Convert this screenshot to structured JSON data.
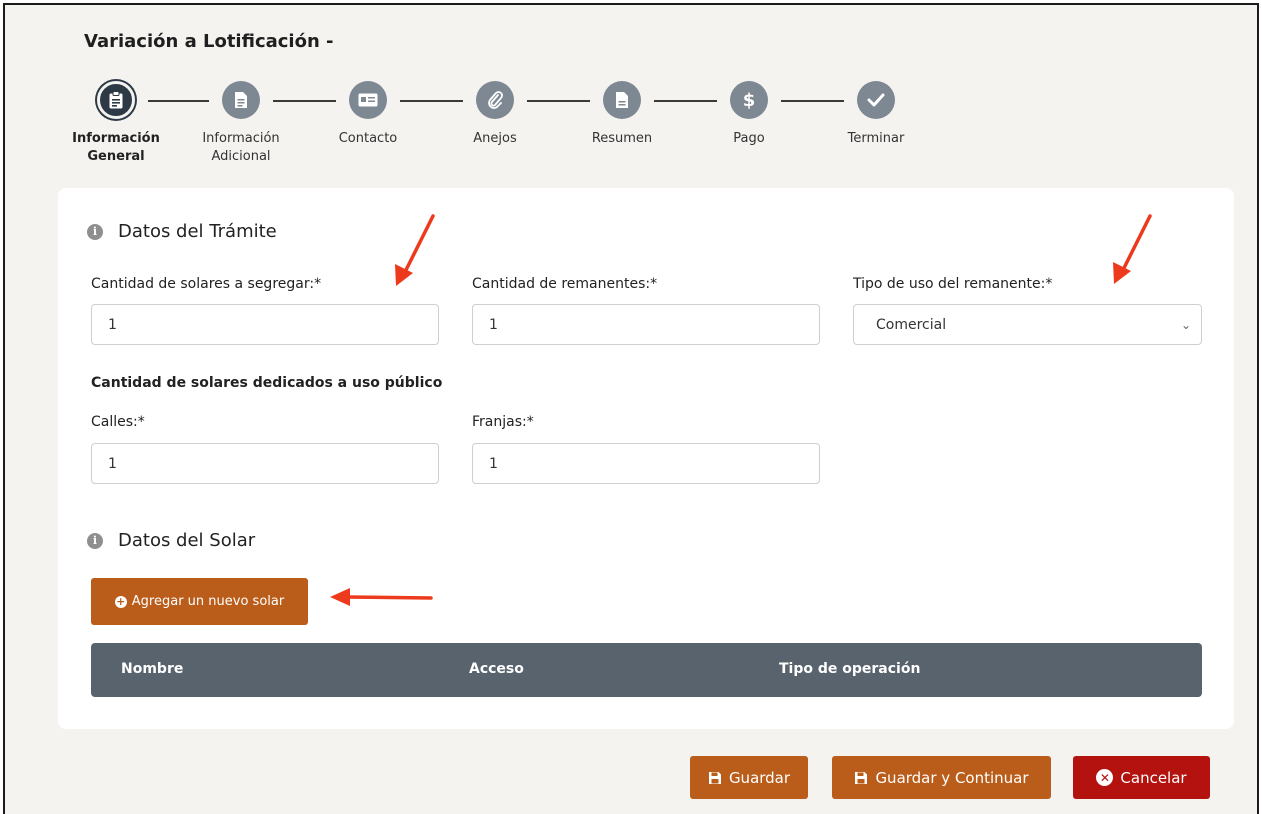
{
  "page": {
    "title": "Variación a Lotificación -"
  },
  "stepper": {
    "steps": [
      {
        "label_line1": "Información",
        "label_line2": "General",
        "icon": "clipboard-icon",
        "active": true
      },
      {
        "label_line1": "Información",
        "label_line2": "Adicional",
        "icon": "document-icon",
        "active": false
      },
      {
        "label_line1": "Contacto",
        "label_line2": "",
        "icon": "id-card-icon",
        "active": false
      },
      {
        "label_line1": "Anejos",
        "label_line2": "",
        "icon": "paperclip-icon",
        "active": false
      },
      {
        "label_line1": "Resumen",
        "label_line2": "",
        "icon": "file-icon",
        "active": false
      },
      {
        "label_line1": "Pago",
        "label_line2": "",
        "icon": "dollar-icon",
        "symbol": "$",
        "active": false
      },
      {
        "label_line1": "Terminar",
        "label_line2": "",
        "icon": "check-icon",
        "active": false
      }
    ]
  },
  "tramite": {
    "section_title": "Datos del Trámite",
    "info_glyph": "i",
    "solares_segregar": {
      "label": "Cantidad de solares a segregar:*",
      "value": "1"
    },
    "remanentes": {
      "label": "Cantidad de remanentes:*",
      "value": "1"
    },
    "tipo_uso": {
      "label": "Tipo de uso del remanente:*",
      "value": "Comercial"
    },
    "uso_publico_heading": "Cantidad de solares dedicados a uso público",
    "calles": {
      "label": "Calles:*",
      "value": "1"
    },
    "franjas": {
      "label": "Franjas:*",
      "value": "1"
    }
  },
  "solar": {
    "section_title": "Datos del Solar",
    "info_glyph": "i",
    "add_button_label": "Agregar un nuevo solar",
    "table_headers": [
      "Nombre",
      "Acceso",
      "Tipo de operación"
    ]
  },
  "footer": {
    "save_label": "Guardar",
    "save_continue_label": "Guardar y Continuar",
    "cancel_label": "Cancelar"
  },
  "colors": {
    "accent": "#bb5d1a",
    "danger": "#b3120f",
    "step_active": "#2d3a45",
    "step_inactive": "#7d8893",
    "table_header": "#58636e",
    "annotation_arrow": "#ee3a1c"
  }
}
